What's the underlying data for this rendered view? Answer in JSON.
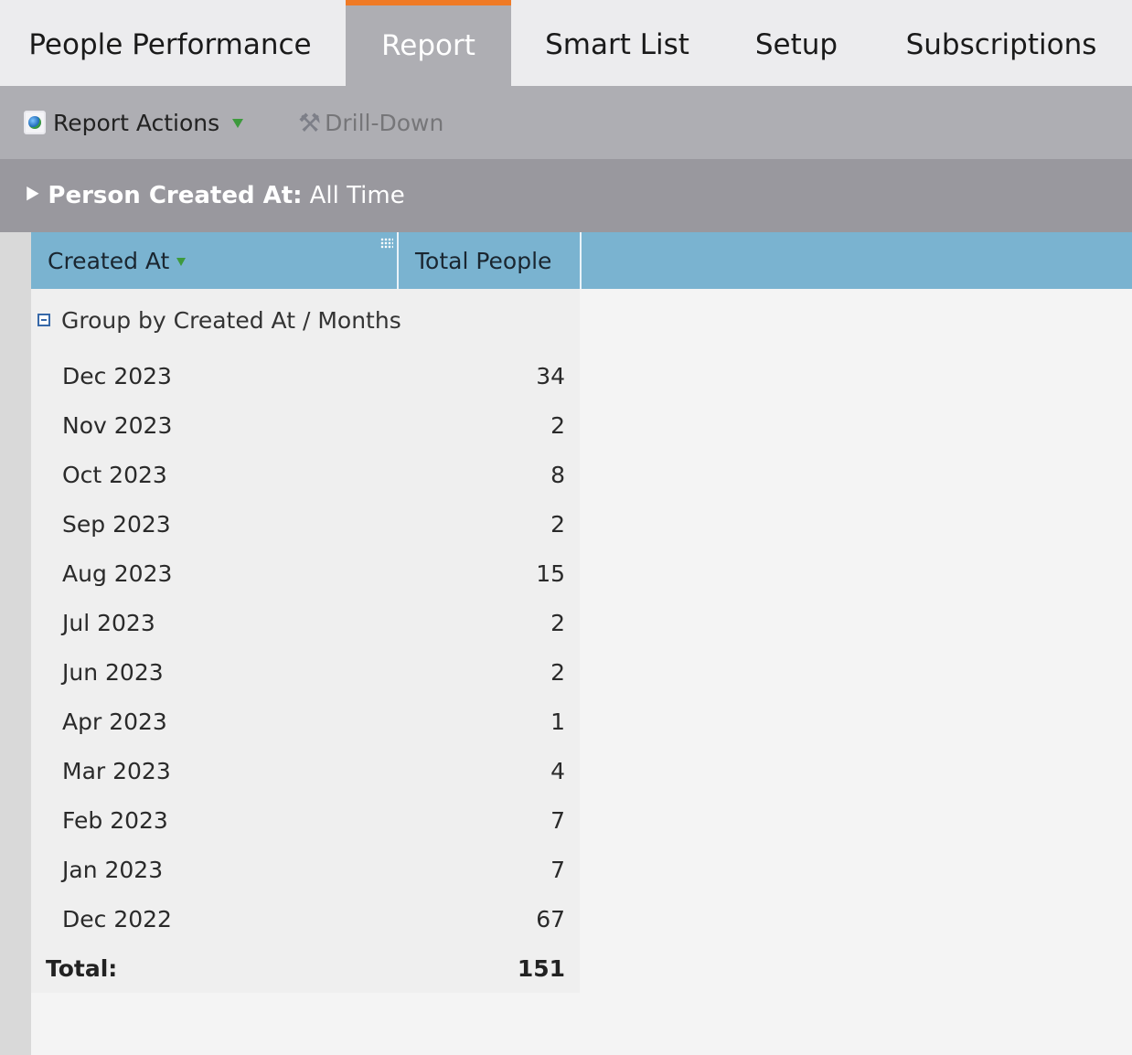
{
  "tabs": [
    {
      "label": "People Performance"
    },
    {
      "label": "Report",
      "active": true
    },
    {
      "label": "Smart List"
    },
    {
      "label": "Setup"
    },
    {
      "label": "Subscriptions"
    }
  ],
  "toolbar": {
    "report_actions": "Report Actions",
    "drill_down": "Drill-Down"
  },
  "filter": {
    "label": "Person Created At:",
    "value": "All Time"
  },
  "grid": {
    "columns": [
      "Created At",
      "Total People"
    ],
    "group_label": "Group by Created At / Months",
    "rows": [
      {
        "month": "Dec 2023",
        "count": "34"
      },
      {
        "month": "Nov 2023",
        "count": "2"
      },
      {
        "month": "Oct 2023",
        "count": "8"
      },
      {
        "month": "Sep 2023",
        "count": "2"
      },
      {
        "month": "Aug 2023",
        "count": "15"
      },
      {
        "month": "Jul 2023",
        "count": "2"
      },
      {
        "month": "Jun 2023",
        "count": "2"
      },
      {
        "month": "Apr 2023",
        "count": "1"
      },
      {
        "month": "Mar 2023",
        "count": "4"
      },
      {
        "month": "Feb 2023",
        "count": "7"
      },
      {
        "month": "Jan 2023",
        "count": "7"
      },
      {
        "month": "Dec 2022",
        "count": "67"
      }
    ],
    "total_label": "Total:",
    "total_value": "151"
  },
  "colors": {
    "accent": "#f07a25",
    "header_blue": "#7ab3d0",
    "toolbar_gray": "#aeaeb3",
    "filter_gray": "#99989e"
  }
}
